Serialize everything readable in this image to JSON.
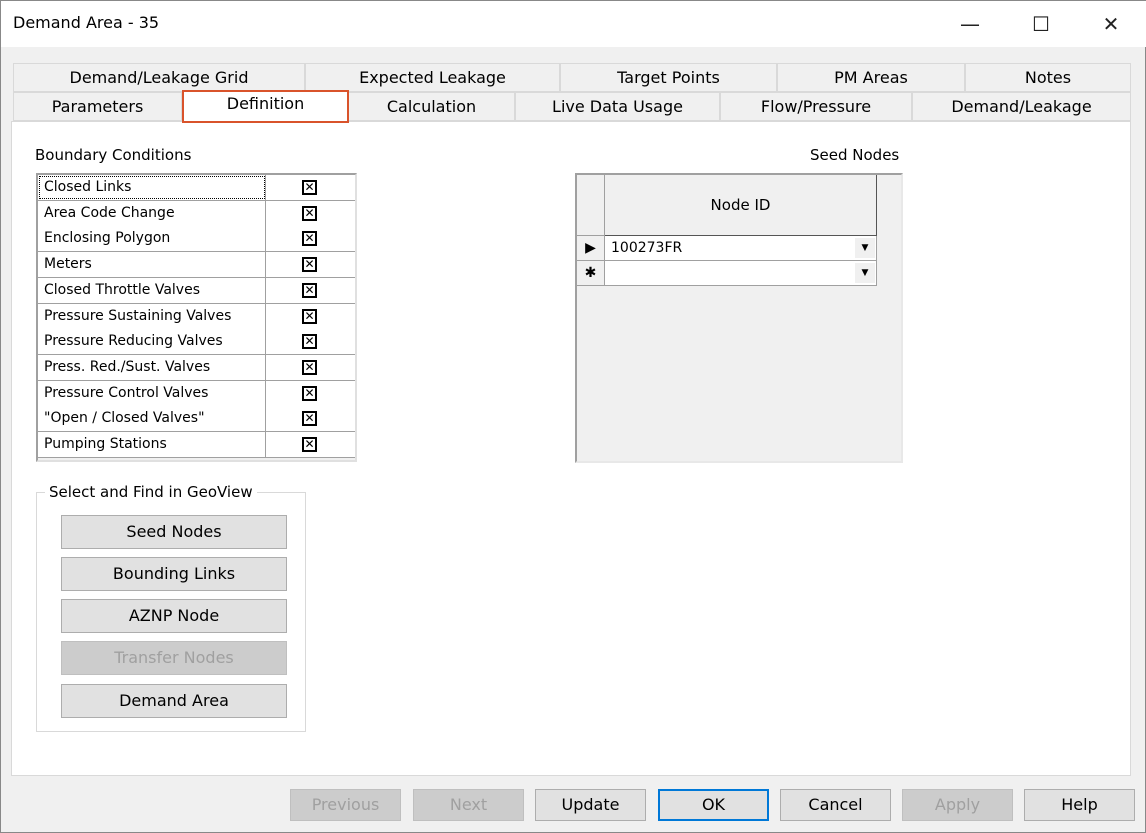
{
  "window": {
    "title": "Demand Area - 35",
    "minimize": "—",
    "maximize": "☐",
    "close": "✕"
  },
  "tabs_row1": [
    "Demand/Leakage Grid",
    "Expected Leakage",
    "Target Points",
    "PM Areas",
    "Notes"
  ],
  "tabs_row2": [
    "Parameters",
    "Definition",
    "Calculation",
    "Live Data Usage",
    "Flow/Pressure",
    "Demand/Leakage"
  ],
  "selected_tab": "Definition",
  "boundary": {
    "title": "Boundary Conditions",
    "rows": [
      {
        "name": "Closed Links",
        "checked": true
      },
      {
        "name": "Area Code Change",
        "checked": true
      },
      {
        "name": "Enclosing Polygon",
        "checked": true
      },
      {
        "name": "Meters",
        "checked": true
      },
      {
        "name": "Closed Throttle Valves",
        "checked": true
      },
      {
        "name": "Pressure Sustaining Valves",
        "checked": true
      },
      {
        "name": "Pressure Reducing Valves",
        "checked": true
      },
      {
        "name": "Press. Red./Sust. Valves",
        "checked": true
      },
      {
        "name": "Pressure Control Valves",
        "checked": true
      },
      {
        "name": "\"Open / Closed Valves\"",
        "checked": true
      },
      {
        "name": "Pumping Stations",
        "checked": true
      }
    ],
    "check_glyph": "✕"
  },
  "geoview": {
    "title": "Select and Find in GeoView",
    "buttons": [
      {
        "label": "Seed Nodes",
        "enabled": true
      },
      {
        "label": "Bounding Links",
        "enabled": true
      },
      {
        "label": "AZNP Node",
        "enabled": true
      },
      {
        "label": "Transfer Nodes",
        "enabled": false
      },
      {
        "label": "Demand Area",
        "enabled": true
      }
    ]
  },
  "seed": {
    "title": "Seed Nodes",
    "header": "Node ID",
    "rows": [
      {
        "indicator": "▶",
        "value": "100273FR"
      },
      {
        "indicator": "✱",
        "value": ""
      }
    ],
    "dropdown": "▼"
  },
  "footer": [
    {
      "label": "Previous",
      "enabled": false
    },
    {
      "label": "Next",
      "enabled": false
    },
    {
      "label": "Update",
      "enabled": true
    },
    {
      "label": "OK",
      "enabled": true,
      "default": true
    },
    {
      "label": "Cancel",
      "enabled": true
    },
    {
      "label": "Apply",
      "enabled": false
    },
    {
      "label": "Help",
      "enabled": true
    }
  ],
  "colors": {
    "selected_tab_outline": "#d9532b",
    "default_button": "#0078d7"
  }
}
